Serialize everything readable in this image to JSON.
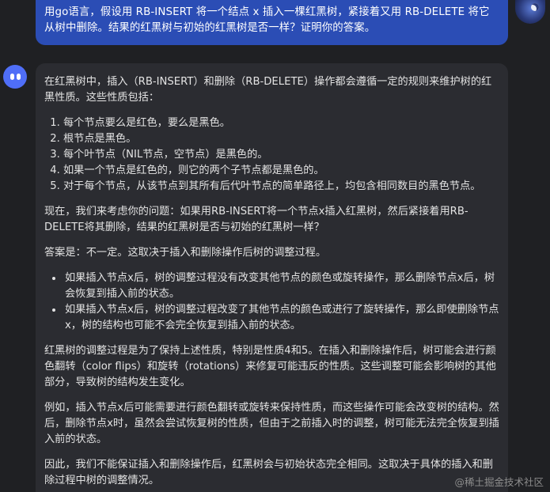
{
  "user_message": {
    "text": "用go语言，假设用 RB-INSERT 将一个结点 x 插入一棵红黑树，紧接着又用 RB-DELETE 将它从树中删除。结果的红黑树与初始的红黑树是否一样？证明你的答案。"
  },
  "assistant_message": {
    "intro": "在红黑树中，插入（RB-INSERT）和删除（RB-DELETE）操作都会遵循一定的规则来维护树的红黑性质。这些性质包括：",
    "properties": [
      "每个节点要么是红色，要么是黑色。",
      "根节点是黑色。",
      "每个叶节点（NIL节点，空节点）是黑色的。",
      "如果一个节点是红色的，则它的两个子节点都是黑色的。",
      "对于每个节点，从该节点到其所有后代叶节点的简单路径上，均包含相同数目的黑色节点。"
    ],
    "question": "现在，我们来考虑你的问题：如果用RB-INSERT将一个节点x插入红黑树，然后紧接着用RB-DELETE将其删除，结果的红黑树是否与初始的红黑树一样？",
    "answer": "答案是：不一定。这取决于插入和删除操作后树的调整过程。",
    "cases": [
      "如果插入节点x后，树的调整过程没有改变其他节点的颜色或旋转操作，那么删除节点x后，树会恢复到插入前的状态。",
      "如果插入节点x后，树的调整过程改变了其他节点的颜色或进行了旋转操作，那么即使删除节点x，树的结构也可能不会完全恢复到插入前的状态。"
    ],
    "explanation": "红黑树的调整过程是为了保持上述性质，特别是性质4和5。在插入和删除操作后，树可能会进行颜色翻转（color flips）和旋转（rotations）来修复可能违反的性质。这些调整可能会影响树的其他部分，导致树的结构发生变化。",
    "example": "例如，插入节点x后可能需要进行颜色翻转或旋转来保持性质，而这些操作可能会改变树的结构。然后，删除节点x时，虽然会尝试恢复树的性质，但由于之前插入时的调整，树可能无法完全恢复到插入前的状态。",
    "conclusion": "因此，我们不能保证插入和删除操作后，红黑树会与初始状态完全相同。这取决于具体的插入和删除过程中树的调整情况。"
  },
  "watermark": "@稀土掘金技术社区",
  "colors": {
    "background": "#1f2023",
    "user_bubble": "#2b4db5",
    "bot_bubble": "#2b2c31",
    "bot_avatar": "#4f6ef7"
  },
  "icons": {
    "user_avatar": "user-avatar-icon",
    "bot_avatar": "bot-avatar-icon"
  }
}
